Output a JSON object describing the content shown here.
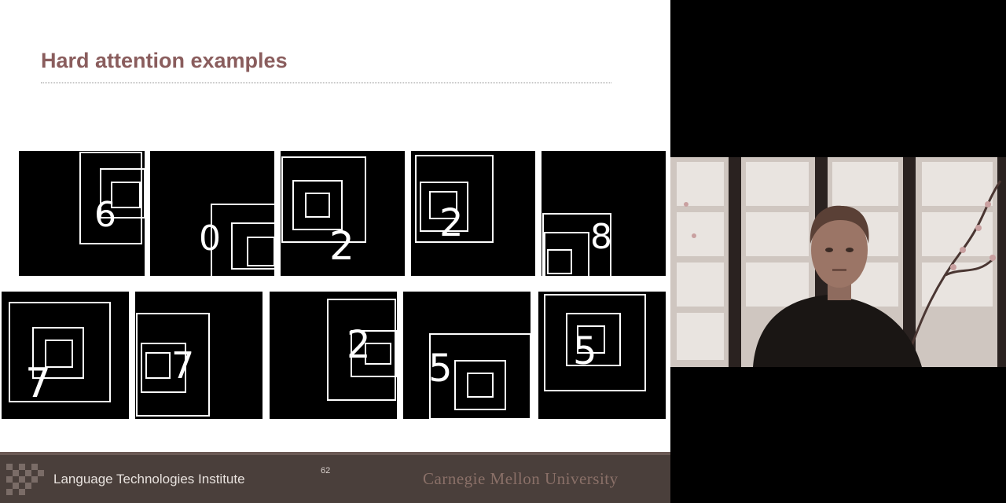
{
  "slide": {
    "title": "Hard attention examples",
    "page_number": "62"
  },
  "figure": {
    "tiles": [
      {
        "digit": "6"
      },
      {
        "digit": "0"
      },
      {
        "digit": "2"
      },
      {
        "digit": "2"
      },
      {
        "digit": "8"
      },
      {
        "digit": "7"
      },
      {
        "digit": "7"
      },
      {
        "digit": "2"
      },
      {
        "digit": "5"
      },
      {
        "digit": "5"
      }
    ]
  },
  "footer": {
    "organization": "Language Technologies Institute",
    "university": "Carnegie Mellon University"
  },
  "webcam": {
    "label": "presenter-video"
  },
  "colors": {
    "title": "#8a5d5d",
    "footer_bg": "#4a3f3b",
    "footer_text": "#e8e2de",
    "university_text": "#8a7068"
  }
}
